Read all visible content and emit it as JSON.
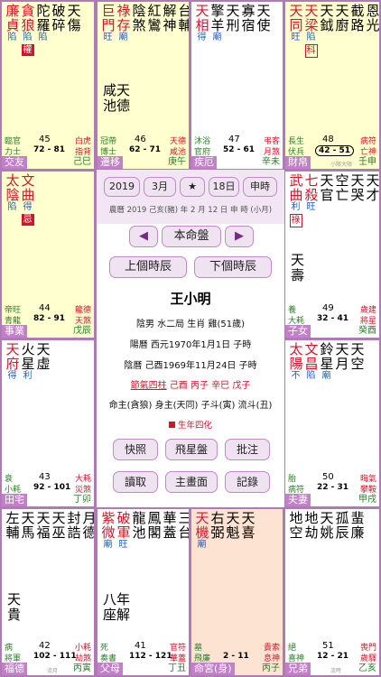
{
  "palaces": [
    {
      "key": "jiaoyou",
      "palace": "交友",
      "gz": "己巳",
      "age": "72 - 81",
      "num": "45",
      "left_top": "臨官",
      "left_bottom": "力士",
      "right_top": "白虎",
      "right_bottom": "指背",
      "stars": [
        {
          "n": "廉",
          "b": "陷",
          "c": "red"
        },
        {
          "n": "貪",
          "b": "陷",
          "c": "red",
          "h": "權"
        },
        {
          "n": "陀",
          "c": "blk",
          "b": "陷"
        },
        {
          "n": "破",
          "c": "blk"
        },
        {
          "n": "天",
          "c": "blk"
        }
      ],
      "stars2": [
        "貞",
        "狼",
        "羅",
        "碎",
        "傷"
      ]
    },
    {
      "key": "qianyi",
      "palace": "遷移",
      "gz": "庚午",
      "age": "62 - 71",
      "num": "46",
      "left_top": "冠帶",
      "left_bottom": "博士",
      "right_top": "天德",
      "right_bottom": "咸池",
      "stars": [
        {
          "n": "巨",
          "c": "red",
          "b": "旺"
        },
        {
          "n": "祿",
          "c": "red",
          "b": "廟"
        },
        {
          "n": "陰",
          "c": "blk"
        },
        {
          "n": "紅",
          "c": "blk"
        },
        {
          "n": "解",
          "c": "blk"
        },
        {
          "n": "台",
          "c": "blk"
        }
      ],
      "stars2": [
        "門",
        "存",
        "煞",
        "鸞",
        "神",
        "輔"
      ],
      "mid": [
        "咸天",
        "池德"
      ]
    },
    {
      "key": "jie",
      "palace": "疾厄",
      "gz": "辛未",
      "age": "52 - 61",
      "num": "47",
      "left_top": "沐浴",
      "left_bottom": "官府",
      "right_top": "弔客",
      "right_bottom": "月煞",
      "stars": [
        {
          "n": "天",
          "c": "red",
          "b": "得"
        },
        {
          "n": "擎",
          "c": "blk",
          "b": "廟"
        },
        {
          "n": "天",
          "c": "blk"
        },
        {
          "n": "寡",
          "c": "blk"
        },
        {
          "n": "天",
          "c": "blk"
        }
      ],
      "stars2": [
        "相",
        "羊",
        "刑",
        "宿",
        "使"
      ]
    },
    {
      "key": "cai",
      "palace": "財帛",
      "gz": "壬申",
      "age": "42 - 51",
      "num": "48",
      "left_top": "長生",
      "left_bottom": "伏兵",
      "right_top": "病符",
      "right_bottom": "亡神",
      "little": "小限大限",
      "stars": [
        {
          "n": "天",
          "c": "red",
          "b": "旺"
        },
        {
          "n": "天",
          "c": "red",
          "b": "陷"
        },
        {
          "n": "天",
          "c": "blk"
        },
        {
          "n": "天",
          "c": "blk"
        },
        {
          "n": "截",
          "c": "blk"
        },
        {
          "n": "恩",
          "c": "blk"
        }
      ],
      "stars2": [
        "同",
        "梁",
        "鉞",
        "廚",
        "路",
        "光"
      ],
      "hk": "科",
      "hkpos": 1
    },
    {
      "key": "shiye",
      "palace": "事業",
      "gz": "戊辰",
      "age": "82 - 91",
      "num": "44",
      "left_top": "帝旺",
      "left_bottom": "青龍",
      "right_top": "龍德",
      "right_bottom": "天煞",
      "stars": [
        {
          "n": "太",
          "c": "red",
          "b": "陷"
        },
        {
          "n": "文",
          "c": "red",
          "b": "得",
          "h": "忌"
        }
      ],
      "stars2": [
        "陰",
        "曲"
      ]
    },
    {
      "key": "zinv",
      "palace": "子女",
      "gz": "癸酉",
      "age": "32 - 41",
      "num": "49",
      "left_top": "養",
      "left_bottom": "大耗",
      "right_top": "歲建",
      "right_bottom": "將星",
      "stars": [
        {
          "n": "武",
          "c": "red",
          "b": "利"
        },
        {
          "n": "七",
          "c": "red",
          "b": "旺"
        },
        {
          "n": "天",
          "c": "blk"
        },
        {
          "n": "空",
          "c": "blk"
        },
        {
          "n": "天",
          "c": "blk"
        },
        {
          "n": "天",
          "c": "blk"
        }
      ],
      "stars2": [
        "曲",
        "殺",
        "官",
        "亡",
        "哭",
        "才"
      ],
      "hk": "祿",
      "hkpos": 0,
      "mid": [
        "天",
        "壽"
      ]
    },
    {
      "key": "tianzhai",
      "palace": "田宅",
      "gz": "丁卯",
      "age": "92 - 101",
      "num": "43",
      "left_top": "衰",
      "left_bottom": "小耗",
      "right_top": "大耗",
      "right_bottom": "災煞",
      "stars": [
        {
          "n": "天",
          "c": "red",
          "b": "得"
        },
        {
          "n": "火",
          "c": "blk",
          "b": "利"
        },
        {
          "n": "天",
          "c": "blk"
        }
      ],
      "stars2": [
        "府",
        "星",
        "虛"
      ]
    },
    {
      "key": "fuqi",
      "palace": "夫妻",
      "gz": "甲戌",
      "age": "22 - 31",
      "num": "50",
      "left_top": "胎",
      "left_bottom": "病符",
      "right_top": "晦氣",
      "right_bottom": "攀鞍",
      "stars": [
        {
          "n": "太",
          "c": "red",
          "b": "不"
        },
        {
          "n": "文",
          "c": "red",
          "b": "陷"
        },
        {
          "n": "鈴",
          "c": "blk",
          "b": "廟"
        },
        {
          "n": "天",
          "c": "blk"
        },
        {
          "n": "天",
          "c": "blk"
        }
      ],
      "stars2": [
        "陽",
        "昌",
        "星",
        "月",
        "空"
      ]
    },
    {
      "key": "fude",
      "palace": "福德",
      "gz": "丙寅",
      "age": "102 - 111",
      "num": "42",
      "left_top": "病",
      "left_bottom": "將軍",
      "right_top": "小耗",
      "right_bottom": "劫煞",
      "little": "流月",
      "stars": [
        {
          "n": "左",
          "c": "blk"
        },
        {
          "n": "天",
          "c": "blk"
        },
        {
          "n": "天",
          "c": "blk"
        },
        {
          "n": "天",
          "c": "blk"
        },
        {
          "n": "封",
          "c": "blk"
        },
        {
          "n": "月",
          "c": "blk"
        }
      ],
      "stars2": [
        "輔",
        "馬",
        "福",
        "巫",
        "誥",
        "德"
      ],
      "mid": [
        "天",
        "貴"
      ]
    },
    {
      "key": "fumu",
      "palace": "父母",
      "gz": "丁丑",
      "age": "112 - 121",
      "num": "41",
      "left_top": "死",
      "left_bottom": "奏書",
      "right_top": "官符",
      "right_bottom": "華蓋",
      "stars": [
        {
          "n": "紫",
          "c": "red",
          "b": "廟"
        },
        {
          "n": "破",
          "c": "red",
          "b": "旺"
        },
        {
          "n": "龍",
          "c": "blk"
        },
        {
          "n": "鳳",
          "c": "blk"
        },
        {
          "n": "華",
          "c": "blk"
        },
        {
          "n": "三",
          "c": "blk"
        }
      ],
      "stars2": [
        "微",
        "軍",
        "池",
        "閣",
        "蓋",
        "台"
      ],
      "mid": [
        "八年",
        "座解"
      ]
    },
    {
      "key": "ming",
      "palace": "命宮(身)",
      "gz": "丙子",
      "age": "2 - 11",
      "num": "",
      "left_top": "墓",
      "left_bottom": "飛廉",
      "right_top": "貴索",
      "right_bottom": "息神",
      "stars": [
        {
          "n": "天",
          "c": "red",
          "b": "廟"
        },
        {
          "n": "右",
          "c": "blk"
        },
        {
          "n": "天",
          "c": "blk"
        },
        {
          "n": "天",
          "c": "blk"
        }
      ],
      "stars2": [
        "機",
        "弼",
        "魁",
        "喜"
      ]
    },
    {
      "key": "xiongdi",
      "palace": "兄弟",
      "gz": "乙亥",
      "age": "12 - 21",
      "num": "51",
      "left_top": "絕",
      "left_bottom": "喜神",
      "right_top": "喪門",
      "right_bottom": "歲驛",
      "little": "流時",
      "stars": [
        {
          "n": "地",
          "c": "blk"
        },
        {
          "n": "地",
          "c": "blk"
        },
        {
          "n": "天",
          "c": "blk"
        },
        {
          "n": "孤",
          "c": "blk"
        },
        {
          "n": "蜚",
          "c": "blk"
        }
      ],
      "stars2": [
        "空",
        "劫",
        "姚",
        "辰",
        "廉"
      ]
    }
  ],
  "center": {
    "year": "2019",
    "month": "3月",
    "star": "★",
    "day": "18日",
    "hour": "申時",
    "lunar": "農曆 2019 己亥(豬) 年 2 月 12 日 申 時 (小月)",
    "chart_btn": "本命盤",
    "prev_btn": "上個時辰",
    "next_btn": "下個時辰",
    "name": "王小明",
    "info1": "陰男 水二局 生肖 雞(51歲)",
    "info2": "陽曆 西元1970年1月1日 子時",
    "info3": "陰曆 己酉1969年11月24日 子時",
    "sizhu_title": "節氣四柱",
    "sizhu_vals": "己酉 丙子 辛巳 戊子",
    "info5": "命主(貪狼) 身主(天同) 子斗(寅) 流斗(丑)",
    "sihua": "生年四化",
    "b1": "快照",
    "b2": "飛星盤",
    "b3": "批注",
    "b4": "讀取",
    "b5": "主畫面",
    "b6": "記錄"
  }
}
